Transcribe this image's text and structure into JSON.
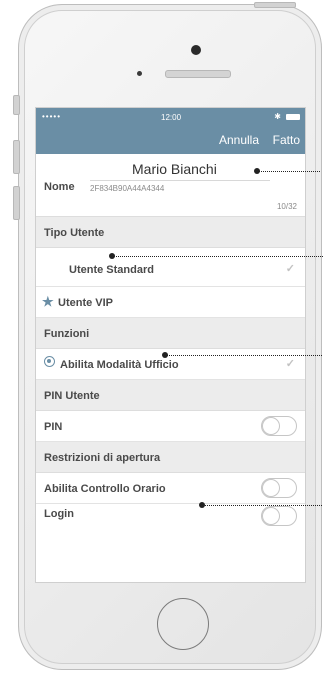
{
  "statusbar": {
    "carrier": "•••••",
    "time": "12:00",
    "bluetooth": "✱"
  },
  "navbar": {
    "cancel": "Annulla",
    "done": "Fatto"
  },
  "user": {
    "full_name": "Mario Bianchi",
    "nome_label": "Nome",
    "nome_value": "2F834B90A44A4344",
    "counter": "10/32"
  },
  "sections": {
    "tipo_utente": "Tipo Utente",
    "funzioni": "Funzioni",
    "pin_utente": "PIN Utente",
    "restrizioni": "Restrizioni di apertura"
  },
  "rows": {
    "utente_standard": "Utente Standard",
    "utente_vip": "Utente VIP",
    "abilita_ufficio": "Abilita Modalità Ufficio",
    "pin": "PIN",
    "controllo_orario": "Abilita Controllo Orario",
    "login": "Login"
  },
  "icons": {
    "check": "✓",
    "star": "★"
  },
  "toggles": {
    "pin": false,
    "controllo_orario": false,
    "login": false
  },
  "colors": {
    "accent": "#6a8ea5",
    "section_bg": "#ececec"
  }
}
